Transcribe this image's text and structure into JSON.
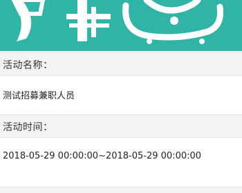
{
  "banner": {
    "color": "#2fb4a6",
    "logo_icon": "logo-illustration-icon"
  },
  "activity_name": {
    "label": "活动名称：",
    "value": "测试招募兼职人员"
  },
  "activity_time": {
    "label": "活动时间：",
    "value": "2018-05-29 00:00:00~2018-05-29 00:00:00"
  }
}
